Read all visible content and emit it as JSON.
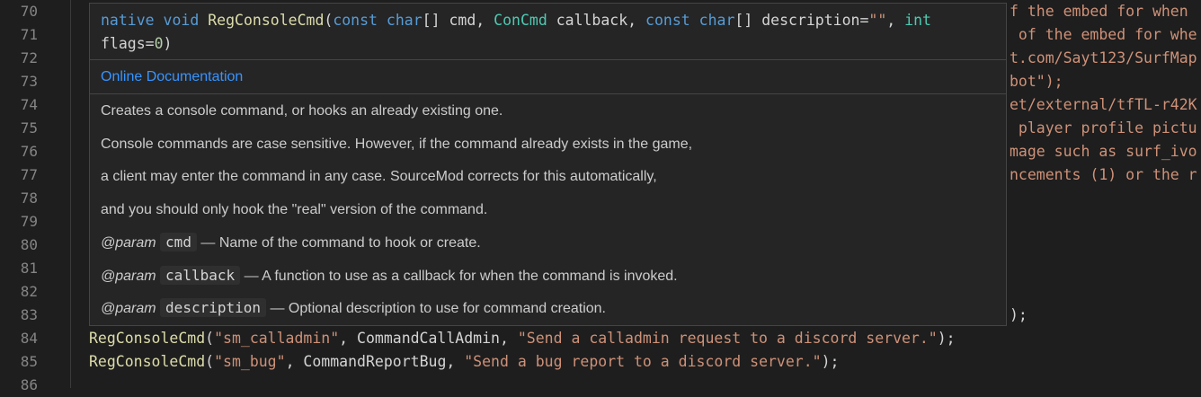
{
  "editor": {
    "line_numbers": [
      "70",
      "71",
      "72",
      "73",
      "74",
      "75",
      "76",
      "77",
      "78",
      "79",
      "80",
      "81",
      "82",
      "83",
      "84",
      "85",
      "86"
    ],
    "right_fragments": [
      "f the embed for when ",
      " of the embed for whe",
      "t.com/Sayt123/SurfMap",
      "bot\");",
      "et/external/tfTL-r42K",
      " player profile pictu",
      "mage such as surf_ivo",
      "ncements (1) or the r"
    ],
    "line83_tail": ");",
    "line84": {
      "fn": "RegConsoleCmd",
      "open": "(",
      "arg1": "\"sm_calladmin\"",
      "mid": ", CommandCallAdmin, ",
      "arg3": "\"Send a calladmin request to a discord server.\"",
      "close": ");"
    },
    "line85": {
      "fn": "RegConsoleCmd",
      "open": "(",
      "arg1": "\"sm_bug\"",
      "mid": ", CommandReportBug, ",
      "arg3": "\"Send a bug report to a discord server.\"",
      "close": ");"
    }
  },
  "hover": {
    "signature": {
      "native": "native",
      "void": "void",
      "name": "RegConsoleCmd",
      "open": "(",
      "const1": "const",
      "char1": "char",
      "p1": "[] cmd, ",
      "type2": "ConCmd",
      "p2": " callback, ",
      "const3": "const",
      "char3": "char",
      "p3": "[] description=",
      "default3": "\"\"",
      "comma": ", ",
      "int4": "int",
      "p4": "flags=",
      "default4": "0",
      "close": ")"
    },
    "doc_link": "Online Documentation",
    "lines": [
      "Creates a console command, or hooks an already existing one.",
      "Console commands are case sensitive. However, if the command already exists in the game,",
      "a client may enter the command in any case. SourceMod corrects for this automatically,",
      "and you should only hook the \"real\" version of the command."
    ],
    "params": [
      {
        "tag": "@param",
        "name": "cmd",
        "desc": "— Name of the command to hook or create."
      },
      {
        "tag": "@param",
        "name": "callback",
        "desc": "— A function to use as a callback for when the command is invoked."
      },
      {
        "tag": "@param",
        "name": "description",
        "desc": "— Optional description to use for command creation."
      }
    ]
  }
}
